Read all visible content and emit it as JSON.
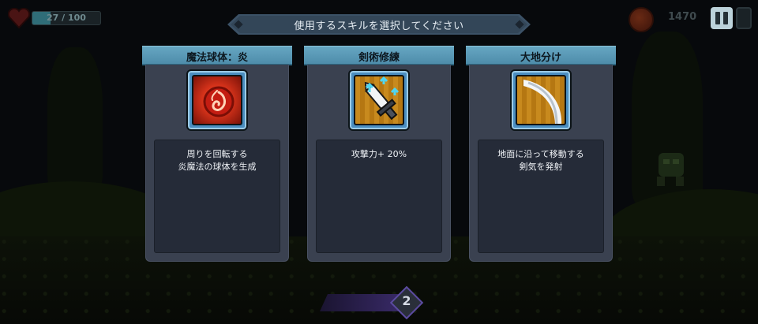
{
  "hud": {
    "hp_text": "27 / 100",
    "hp_fraction": 0.27,
    "coins": "1470"
  },
  "banner": {
    "text": "使用するスキルを選択してください"
  },
  "skills": [
    {
      "title": "魔法球体：炎",
      "icon": "fire-orb-icon",
      "desc_lines": [
        "周りを回転する",
        "炎魔法の球体を生成"
      ]
    },
    {
      "title": "剣術修練",
      "icon": "sword-upgrade-icon",
      "desc_lines": [
        "攻撃力+ 20%"
      ]
    },
    {
      "title": "大地分け",
      "icon": "earth-slash-icon",
      "desc_lines": [
        "地面に沿って移動する",
        "剣気を発射"
      ]
    }
  ],
  "counter": {
    "value": "2"
  },
  "colors": {
    "tab": "#5a9ab8",
    "panel": "#3a4150",
    "desc_bg": "#252b38",
    "banner": "#3b5166"
  }
}
